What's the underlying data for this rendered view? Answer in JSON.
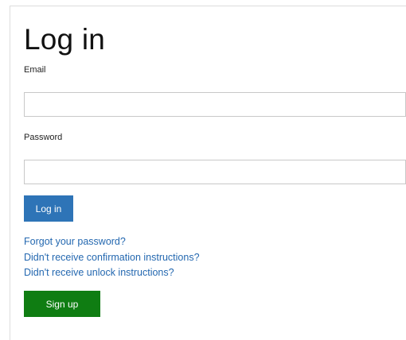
{
  "page": {
    "title": "Log in"
  },
  "form": {
    "email_label": "Email",
    "email_value": "",
    "password_label": "Password",
    "password_value": "",
    "submit_label": "Log in"
  },
  "links": {
    "forgot_password": "Forgot your password?",
    "confirmation": "Didn't receive confirmation instructions?",
    "unlock": "Didn't receive unlock instructions?"
  },
  "signup": {
    "label": "Sign up"
  },
  "colors": {
    "login_button": "#2e74b7",
    "signup_button": "#0f7d12",
    "link": "#2468b0"
  }
}
